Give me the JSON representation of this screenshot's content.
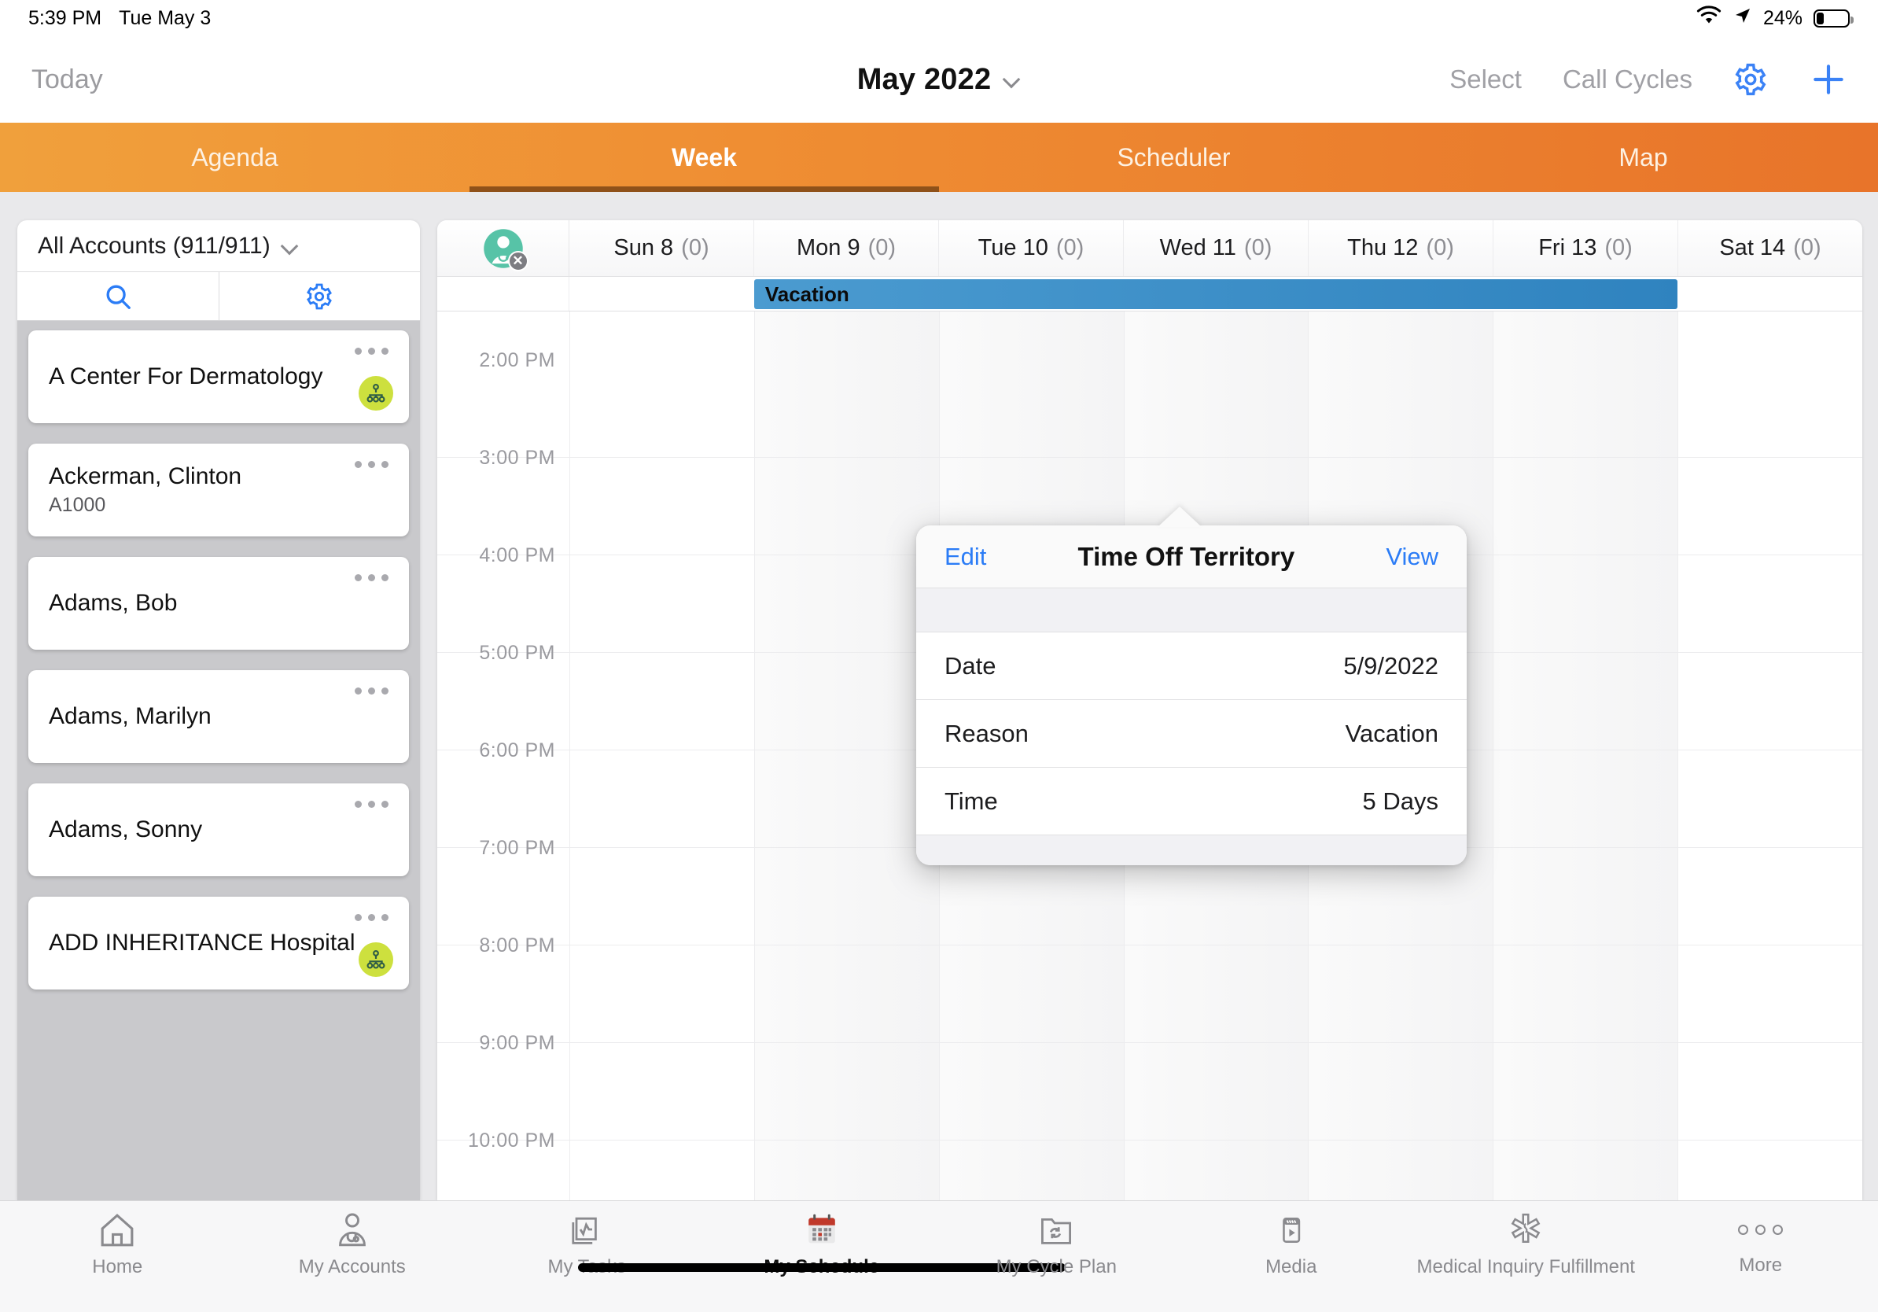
{
  "status_bar": {
    "time": "5:39 PM",
    "date": "Tue May 3",
    "battery_percent": "24%",
    "wifi_icon": "wifi-icon",
    "location_icon": "location-arrow-icon",
    "battery_icon": "battery-icon"
  },
  "nav": {
    "today_label": "Today",
    "title": "May 2022",
    "title_chevron_icon": "chevron-down-icon",
    "select_label": "Select",
    "call_cycles_label": "Call Cycles",
    "gear_icon": "gear-icon",
    "add_icon": "plus-icon",
    "accent_blue": "#3b82f6"
  },
  "tabs": {
    "items": [
      {
        "label": "Agenda",
        "active": false
      },
      {
        "label": "Week",
        "active": true
      },
      {
        "label": "Scheduler",
        "active": false
      },
      {
        "label": "Map",
        "active": false
      }
    ],
    "gradient_start": "#f0a03c",
    "gradient_end": "#e8742a",
    "active_underline": "#8f5119"
  },
  "sidebar": {
    "filter_label": "All Accounts (911/911)",
    "filter_chevron_icon": "chevron-down-icon",
    "search_icon": "search-icon",
    "settings_icon": "gear-icon",
    "badge_color": "#cde03e",
    "accounts": [
      {
        "name": "A Center For Dermatology",
        "sub": "",
        "badge": "hierarchy-icon",
        "stacked": true
      },
      {
        "name": "Ackerman, Clinton",
        "sub": "A1000",
        "badge": "",
        "stacked": false
      },
      {
        "name": "Adams, Bob",
        "sub": "",
        "badge": "",
        "stacked": false
      },
      {
        "name": "Adams, Marilyn",
        "sub": "",
        "badge": "",
        "stacked": false
      },
      {
        "name": "Adams, Sonny",
        "sub": "",
        "badge": "",
        "stacked": false
      },
      {
        "name": "ADD INHERITANCE Hospital",
        "sub": "",
        "badge": "hierarchy-icon",
        "stacked": false
      }
    ]
  },
  "calendar": {
    "territory_icon": "doctor-unavailable-icon",
    "days": [
      {
        "label": "Sun 8",
        "count": "(0)"
      },
      {
        "label": "Mon 9",
        "count": "(0)"
      },
      {
        "label": "Tue 10",
        "count": "(0)"
      },
      {
        "label": "Wed 11",
        "count": "(0)"
      },
      {
        "label": "Thu 12",
        "count": "(0)"
      },
      {
        "label": "Fri 13",
        "count": "(0)"
      },
      {
        "label": "Sat 14",
        "count": "(0)"
      }
    ],
    "all_day_event": {
      "label": "Vacation",
      "color": "#2f83bf",
      "start_day_index": 1,
      "end_day_index": 5
    },
    "hours": [
      "2:00 PM",
      "3:00 PM",
      "4:00 PM",
      "5:00 PM",
      "6:00 PM",
      "7:00 PM",
      "8:00 PM",
      "9:00 PM",
      "10:00 PM"
    ]
  },
  "popover": {
    "edit_label": "Edit",
    "title": "Time Off Territory",
    "view_label": "View",
    "rows": [
      {
        "key": "Date",
        "value": "5/9/2022"
      },
      {
        "key": "Reason",
        "value": "Vacation"
      },
      {
        "key": "Time",
        "value": "5 Days"
      }
    ]
  },
  "bottom_nav": {
    "items": [
      {
        "label": "Home",
        "icon": "home-icon",
        "active": false
      },
      {
        "label": "My Accounts",
        "icon": "person-stethoscope-icon",
        "active": false
      },
      {
        "label": "My Tasks",
        "icon": "tasks-document-icon",
        "active": false
      },
      {
        "label": "My Schedule",
        "icon": "calendar-icon",
        "active": true
      },
      {
        "label": "My Cycle Plan",
        "icon": "folder-refresh-icon",
        "active": false
      },
      {
        "label": "Media",
        "icon": "media-play-icon",
        "active": false
      },
      {
        "label": "Medical Inquiry Fulfillment",
        "icon": "medical-star-icon",
        "active": false
      },
      {
        "label": "More",
        "icon": "more-dots-icon",
        "active": false
      }
    ]
  }
}
